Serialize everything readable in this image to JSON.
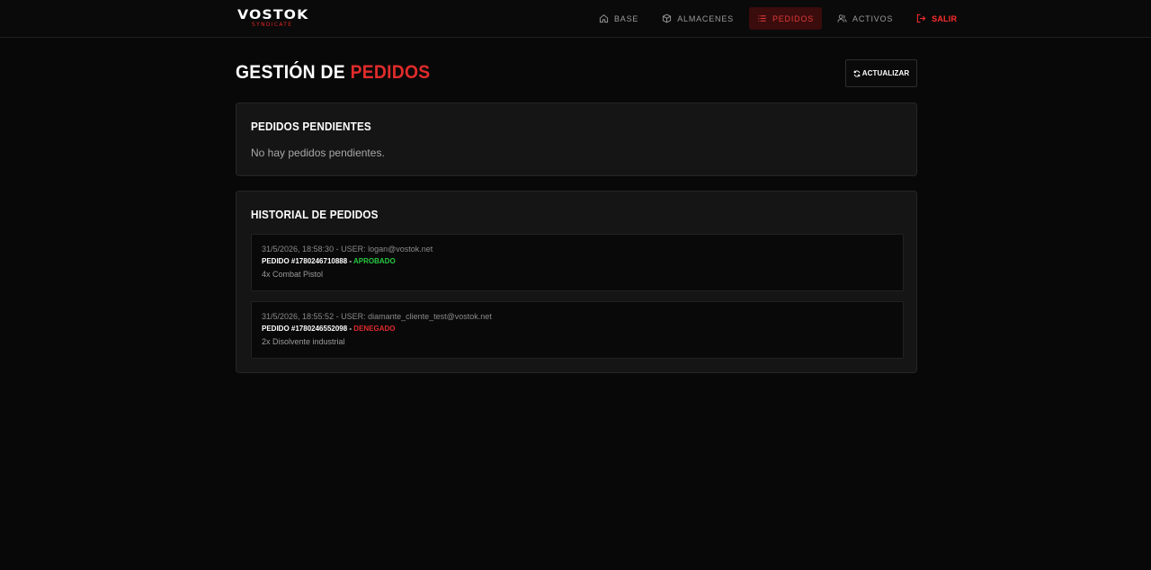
{
  "brand": {
    "name": "VOSTOK",
    "tagline": "SYNDICATE",
    "accent_color": "#e02424"
  },
  "nav": {
    "items": [
      {
        "label": "BASE",
        "icon": "home-icon"
      },
      {
        "label": "ALMACENES",
        "icon": "box-icon"
      },
      {
        "label": "PEDIDOS",
        "icon": "list-icon",
        "active": true
      },
      {
        "label": "ACTIVOS",
        "icon": "users-icon"
      }
    ],
    "logout": {
      "label": "SALIR",
      "icon": "logout-icon"
    }
  },
  "page": {
    "title_prefix": "GESTIÓN DE ",
    "title_accent": "PEDIDOS",
    "refresh_label": "ACTUALIZAR"
  },
  "pending": {
    "title": "PEDIDOS PENDIENTES",
    "empty_text": "No hay pedidos pendientes."
  },
  "history": {
    "title": "HISTORIAL DE PEDIDOS",
    "orders": [
      {
        "meta": "31/5/2026, 18:58:30 - USER: logan@vostok.net",
        "id_label": "PEDIDO #1780246710888 - ",
        "status": "APROBADO",
        "status_color": "#27c93f",
        "items": "4x Combat Pistol"
      },
      {
        "meta": "31/5/2026, 18:55:52 - USER: diamante_cliente_test@vostok.net",
        "id_label": "PEDIDO #1780246552098 - ",
        "status": "DENEGADO",
        "status_color": "#e02b2b",
        "items": "2x Disolvente industrial"
      }
    ]
  }
}
